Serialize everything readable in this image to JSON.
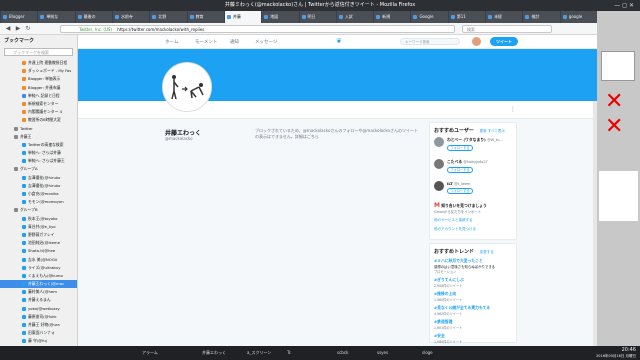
{
  "window": {
    "title": "井藤ミわっく(@mackolacko)さん | Twitterから返信付きツイート - Mozilla Firefox",
    "controls": "— ◻ ✕"
  },
  "tabs": [
    "Blogger",
    "単純な",
    "最後の",
    "水前寺",
    "北野",
    "教育",
    "井藤",
    "地図",
    "明日",
    "入試",
    "新規",
    "Google",
    "第11",
    "未経",
    "検討",
    "google"
  ],
  "nav": {
    "back": "◀",
    "forward": "▶",
    "reload": "↻",
    "url_label": "Twitter, Inc. (US)",
    "url": "https://twitter.com/mackolacko/with_replies",
    "search_placeholder": "検索"
  },
  "sidebar": {
    "title": "ブックマーク",
    "search_placeholder": "ブックマークを検索",
    "items": [
      {
        "label": "井達上院 運動教授日程",
        "color": "#f28c28"
      },
      {
        "label": "ダッシュボード - My Fas",
        "color": "#f28c28"
      },
      {
        "label": "Blogger: 単価表示",
        "color": "#f28c28"
      },
      {
        "label": "Blogger: 井連市議",
        "color": "#f28c28"
      },
      {
        "label": "単純へ 記録と日程",
        "color": "#3d8ee8"
      },
      {
        "label": "新規検索センター",
        "color": "#f28c28"
      },
      {
        "label": "内閣閣議センター 4",
        "color": "#f28c28"
      },
      {
        "label": "教習所の8時間大変",
        "color": "#f28c28"
      },
      {
        "label": "Twitter",
        "color": "#888"
      },
      {
        "label": "井藤王",
        "color": "#888"
      },
      {
        "label": "Twitterの高速な検索",
        "color": "#1da1f2"
      },
      {
        "label": "単純へ: さらば井藤",
        "color": "#1da1f2"
      },
      {
        "label": "単純へ: さらば井藤王",
        "color": "#1da1f2"
      },
      {
        "label": "グループA",
        "color": "#888"
      },
      {
        "label": "吉澤優花(@hiruko",
        "color": "#1da1f2"
      },
      {
        "label": "吉澤優花(@hiruko",
        "color": "#1da1f2"
      },
      {
        "label": "小倉充(@monika",
        "color": "#1da1f2"
      },
      {
        "label": "モモン(@momoyon",
        "color": "#1da1f2"
      },
      {
        "label": "グループB",
        "color": "#888"
      },
      {
        "label": "秋本王(@toyoko",
        "color": "#1da1f2"
      },
      {
        "label": "青谷井(@e_kyo",
        "color": "#1da1f2"
      },
      {
        "label": "野野暮ガフレイ",
        "color": "#1da1f2"
      },
      {
        "label": "池田純治(@ikeme",
        "color": "#1da1f2"
      },
      {
        "label": "Shota-ti(@hee",
        "color": "#1da1f2"
      },
      {
        "label": "吉水 美(@NOGU",
        "color": "#1da1f2"
      },
      {
        "label": "ライズ(@ultrabuy",
        "color": "#1da1f2"
      },
      {
        "label": "くまえもん(@kumo",
        "color": "#1da1f2"
      },
      {
        "label": "井藤王わっく(@mac",
        "color": "#1da1f2"
      },
      {
        "label": "藤村美人(@hem",
        "color": "#1da1f2"
      },
      {
        "label": "井藤えるまん",
        "color": "#1da1f2"
      },
      {
        "label": "yoko(@wetkozzy",
        "color": "#1da1f2"
      },
      {
        "label": "藤原俊司(@fukk",
        "color": "#1da1f2"
      },
      {
        "label": "井藤王 好物(@ura",
        "color": "#1da1f2"
      },
      {
        "label": "田東園バンナォ",
        "color": "#1da1f2"
      },
      {
        "label": "藤 守(@fuj",
        "color": "#1da1f2"
      }
    ],
    "selected_index": 27
  },
  "twitter": {
    "nav": [
      "ホーム",
      "モーメント",
      "通知",
      "メッセージ"
    ],
    "search_placeholder": "キーワード検索",
    "tweet_button": "ツイート",
    "display_name": "井藤エわっく",
    "handle": "@mackolacko",
    "block_message": "ブロックされているため、@mackolackoさんのフォローや@mackolackoさんのツイートの表示はできません。詳細はこちら",
    "wtf": {
      "title": "おすすめユーザー",
      "links": "更新 すべて表示",
      "users": [
        {
          "name": "わとべー (ワタなまり)",
          "handle": "@W_tu...",
          "button": "フォローする",
          "color": "#8a9aa0"
        },
        {
          "name": "こたべる",
          "handle": "@kaikyjn6s27",
          "button": "フォローする",
          "color": "#777"
        },
        {
          "name": "ILT",
          "handle": "@t_ileem",
          "button": "フォローする",
          "color": "#555"
        }
      ],
      "gmail_title": "知り合いを見つけましょう",
      "gmail_sub": "Gmailから友だちをインポート",
      "connect": "他のサービスと接続する",
      "more": "他のアカウントを見つける"
    },
    "trends": {
      "title": "おすすめトレンド",
      "change": "変更する",
      "items": [
        {
          "tag": "#ミハに秋月で大変ったこと",
          "desc": "感想のはい意味さも知らぬばかりできる",
          "count": "プロモーション"
        },
        {
          "tag": "#ぎりてんにしぶ",
          "desc": "",
          "count": "2,908件のツイート"
        },
        {
          "tag": "#推移の上向",
          "desc": "",
          "count": "1,960件のツイート"
        },
        {
          "tag": "#見なく公開が全てる実力もてる",
          "desc": "",
          "count": "4,962件のツイート"
        },
        {
          "tag": "#鉄道管理",
          "desc": "",
          "count": "1,601件のツイート"
        },
        {
          "tag": "#安全",
          "desc": "",
          "count": "1,080件のツイート"
        }
      ]
    }
  },
  "taskbar": {
    "tasks": [
      "アラーム",
      "井藤エわっく",
      "a_スクリーン",
      "Tc",
      "scbck",
      "ssyes",
      "sloge"
    ],
    "time": "20:46",
    "date": "2016年05月16日 月曜日"
  }
}
